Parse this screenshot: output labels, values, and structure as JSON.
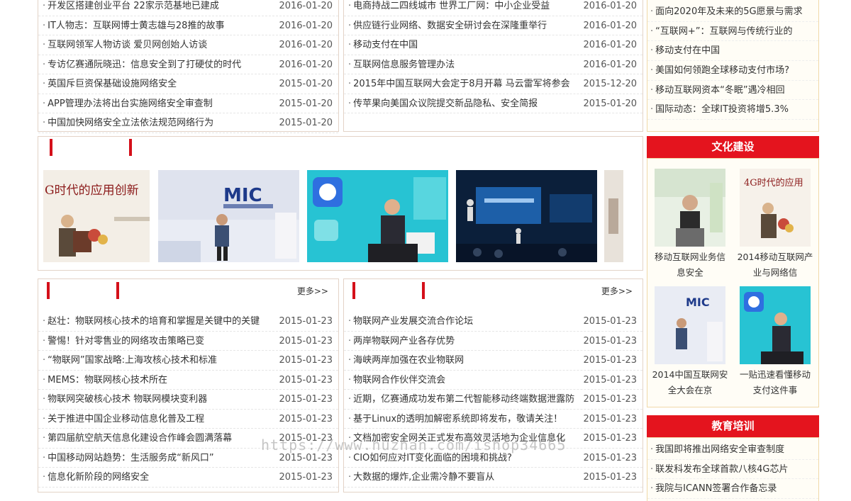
{
  "top_left_list": [
    {
      "title": "开发区搭建创业平台 22家示范基地已建成",
      "date": "2016-01-20"
    },
    {
      "title": "IT人物志：互联网博士黄志雄与28推的故事",
      "date": "2016-01-20"
    },
    {
      "title": "互联网领军人物访谈 爱贝网创始人访谈",
      "date": "2016-01-20"
    },
    {
      "title": "专访亿赛通阮晓迅：信息安全到了打硬仗的时代",
      "date": "2016-01-20"
    },
    {
      "title": "英国斥巨资保基础设施网络安全",
      "date": "2015-01-20"
    },
    {
      "title": "APP管理办法将出台实施网络安全审查制",
      "date": "2015-01-20"
    },
    {
      "title": "中国加快网络安全立法依法规范网络行为",
      "date": "2015-01-20"
    }
  ],
  "top_right_list": [
    {
      "title": "电商持战二四线城市 世界工厂网：中小企业受益",
      "date": "2016-01-20"
    },
    {
      "title": "供应链行业网络、数据安全研讨会在深隆重举行",
      "date": "2016-01-20"
    },
    {
      "title": "移动支付在中国",
      "date": "2016-01-20"
    },
    {
      "title": "互联网信息服务管理办法",
      "date": "2016-01-20"
    },
    {
      "title": "2015年中国互联网大会定于8月开幕 马云雷军将参会",
      "date": "2015-12-20"
    },
    {
      "title": "传苹果向美国众议院提交新品隐私、安全简报",
      "date": "2015-01-20"
    }
  ],
  "side_top_list": [
    "面向2020年及未来的5G愿景与需求",
    "“互联网+”：互联网与传统行业的",
    "移动支付在中国",
    "美国如何领跑全球移动支付市场?",
    "移动互联网资本“冬眠”遇冷相回",
    "国际动态：全球IT投资将增5.3%"
  ],
  "gallery": [
    {
      "icon": "speaker-podium-photo"
    },
    {
      "icon": "mic-conference-photo"
    },
    {
      "icon": "baidu-talk-photo"
    },
    {
      "icon": "stage-event-photo"
    },
    {
      "icon": "partial-photo"
    }
  ],
  "culture": {
    "title": "文化建设",
    "items": [
      {
        "caption": "移动互联网业务信息安全"
      },
      {
        "caption": "2014移动互联网产业与网络信"
      },
      {
        "caption": "2014中国互联网安全大会在京"
      },
      {
        "caption": "一贴迅速看懂移动支付这件事"
      }
    ]
  },
  "education": {
    "title": "教育培训",
    "items": [
      "我国即将推出网络安全审查制度",
      "联发科发布全球首款八核4G芯片",
      "我院与ICANN签署合作备忘录"
    ]
  },
  "bottom_left": {
    "more": "更多>>",
    "items": [
      {
        "title": "赵壮：物联网核心技术的培育和掌握是关键中的关键",
        "date": "2015-01-23"
      },
      {
        "title": "警惕！针对零售业的网络攻击策略已变",
        "date": "2015-01-23"
      },
      {
        "title": "“物联网”国家战略:上海攻核心技术和标准",
        "date": "2015-01-23"
      },
      {
        "title": "MEMS：物联网核心技术所在",
        "date": "2015-01-23"
      },
      {
        "title": "物联网突破核心技术 物联网模块变利器",
        "date": "2015-01-23"
      },
      {
        "title": "关于推进中国企业移动信息化普及工程",
        "date": "2015-01-23"
      },
      {
        "title": "第四届航空航天信息化建设合作峰会圆满落幕",
        "date": "2015-01-23"
      },
      {
        "title": "中国移动网站趋势：生活服务成“新风口”",
        "date": "2015-01-23"
      },
      {
        "title": "信息化新阶段的网络安全",
        "date": "2015-01-23"
      }
    ]
  },
  "bottom_right": {
    "more": "更多>>",
    "items": [
      {
        "title": "物联网产业发展交流合作论坛",
        "date": "2015-01-23"
      },
      {
        "title": "两岸物联网产业各存优势",
        "date": "2015-01-23"
      },
      {
        "title": "海峡两岸加强在农业物联网",
        "date": "2015-01-23"
      },
      {
        "title": "物联网合作伙伴交流会",
        "date": "2015-01-23"
      },
      {
        "title": "近期，亿赛通成功发布第二代智能移动终端数据泄露防",
        "date": "2015-01-23"
      },
      {
        "title": "基于Linux的透明加解密系统即将发布，敬请关注！",
        "date": "2015-01-23"
      },
      {
        "title": "文档加密安全网关正式发布高效灵活地为企业信息化",
        "date": "2015-01-23"
      },
      {
        "title": "CIO如何应对IT变化面临的困境和挑战?",
        "date": "2015-01-23"
      },
      {
        "title": "大数据的爆炸,企业需冷静不要盲从",
        "date": "2015-01-23"
      }
    ]
  },
  "watermark": "https://www.huzhan.com/ishop34665",
  "colors": {
    "accent_red": "#e4141e",
    "bar_red": "#d4101a",
    "border": "#e3d3c7"
  }
}
